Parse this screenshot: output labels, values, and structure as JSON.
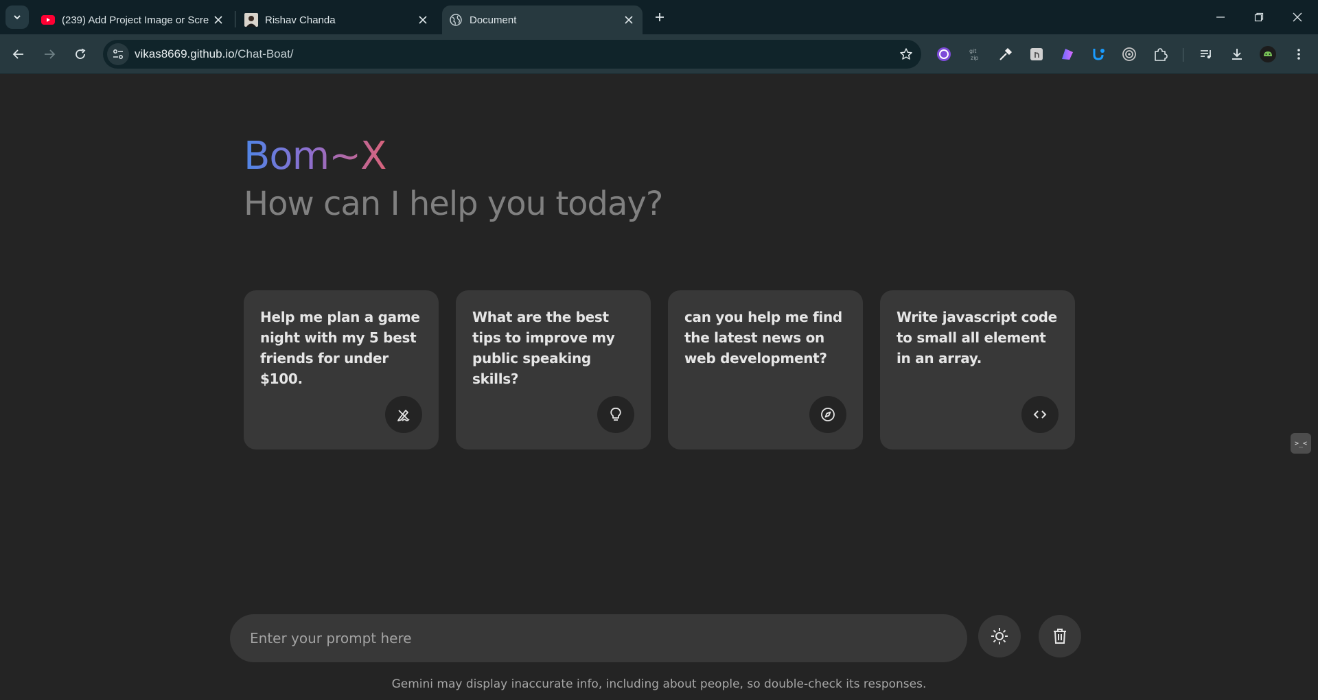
{
  "browser": {
    "tabs": [
      {
        "title": "(239) Add Project Image or Scre",
        "favicon": "youtube-icon"
      },
      {
        "title": "Rishav Chanda",
        "favicon": "avatar-icon"
      },
      {
        "title": "Document",
        "favicon": "globe-icon",
        "active": true
      }
    ],
    "url": {
      "host": "vikas8669.github.io",
      "path": "/Chat-Boat/"
    },
    "extensions": [
      "wappalyzer-icon",
      "git-zip-icon",
      "eyedropper-icon",
      "touch-icon",
      "shape-icon",
      "tool-icon",
      "target-icon",
      "puzzle-icon",
      "media-queue-icon",
      "download-icon",
      "profile-avatar-icon",
      "menu-icon"
    ],
    "ext_labels": {
      "gitzip": "Git\nZip"
    }
  },
  "app": {
    "brand": "Bom~X",
    "subtitle": "How can I help you today?",
    "suggestions": [
      {
        "text": "Help me plan a game night with my 5 best friends for under $100.",
        "icon": "draw-icon"
      },
      {
        "text": "What are the best tips to improve my public speaking skills?",
        "icon": "lightbulb-icon"
      },
      {
        "text": "can you help me find the latest news on web development?",
        "icon": "explore-icon"
      },
      {
        "text": "Write javascript code to small all element in an array.",
        "icon": "code-icon"
      }
    ],
    "prompt": {
      "placeholder": "Enter your prompt here",
      "value": ""
    },
    "side_widget": ">_<",
    "disclaimer": "Gemini may display inaccurate info, including about people, so double-check its responses.",
    "colors": {
      "background": "#242424",
      "card": "#383838",
      "brand_start": "#4f86e6",
      "brand_end": "#d9637a"
    }
  }
}
